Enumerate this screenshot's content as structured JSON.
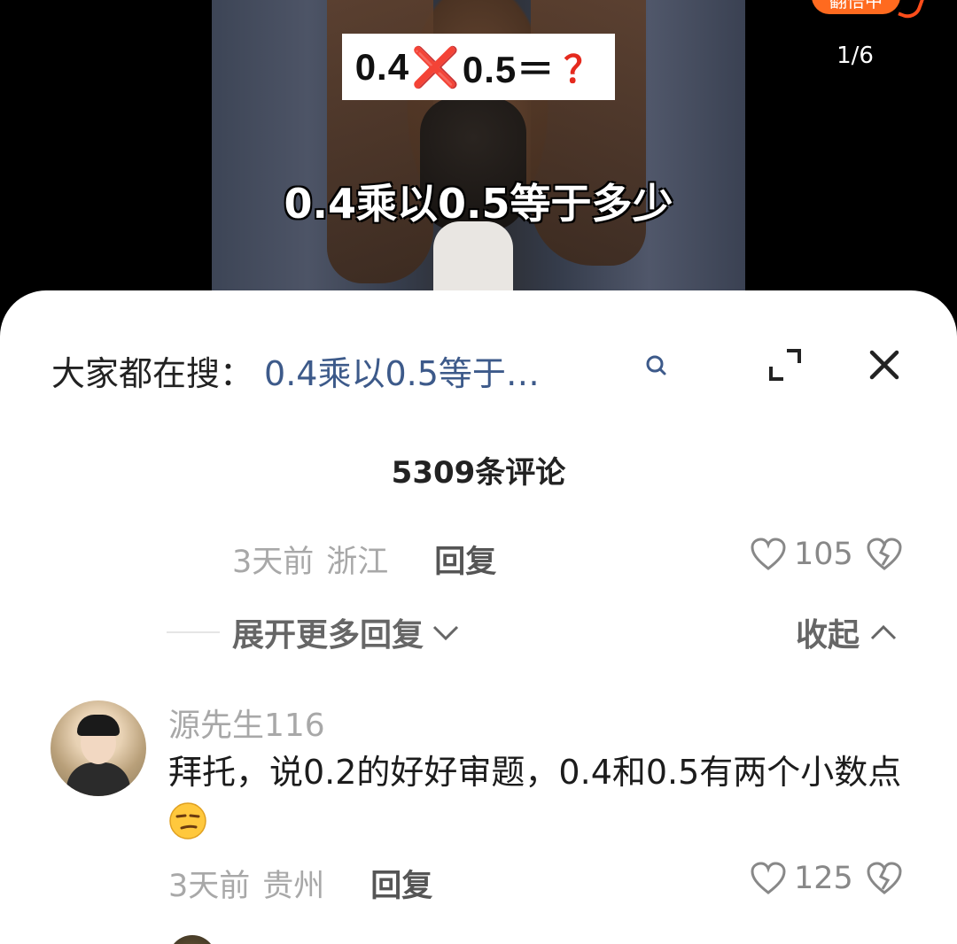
{
  "video": {
    "equation_left": "0.4",
    "equation_x": "❌",
    "equation_right": "0.5＝",
    "equation_q": "？",
    "subtitle": "0.4乘以0.5等于多少",
    "page_counter": "1/6",
    "badge_text": "翻倍中"
  },
  "sheet": {
    "search_prefix": "大家都在搜：",
    "search_query": "0.4乘以0.5等于…",
    "comment_count": "5309条评论"
  },
  "comments": [
    {
      "time": "3天前",
      "location": "浙江",
      "reply_label": "回复",
      "likes": "105"
    },
    {
      "username": "源先生116",
      "text": "拜托，说0.2的好好审题，0.4和0.5有两个小数点",
      "time": "3天前",
      "location": "贵州",
      "reply_label": "回复",
      "likes": "125"
    }
  ],
  "thread": {
    "more_replies_label": "展开更多回复",
    "collapse_label": "收起"
  },
  "colors": {
    "link_blue": "#3d5a8a",
    "accent_orange": "#ff6a1f",
    "alert_red": "#e52a1e"
  }
}
